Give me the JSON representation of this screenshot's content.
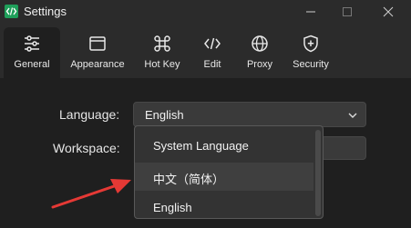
{
  "window": {
    "title": "Settings",
    "controls": [
      "minimize",
      "maximize",
      "close"
    ]
  },
  "tabs": [
    {
      "label": "General",
      "icon": "sliders-icon",
      "active": true
    },
    {
      "label": "Appearance",
      "icon": "window-icon",
      "active": false
    },
    {
      "label": "Hot Key",
      "icon": "command-icon",
      "active": false
    },
    {
      "label": "Edit",
      "icon": "code-icon",
      "active": false
    },
    {
      "label": "Proxy",
      "icon": "globe-icon",
      "active": false
    },
    {
      "label": "Security",
      "icon": "shield-icon",
      "active": false
    }
  ],
  "general": {
    "language_label": "Language:",
    "language_value": "English",
    "workspace_label": "Workspace:"
  },
  "language_options": [
    "System Language",
    "中文（简体）",
    "English"
  ],
  "colors": {
    "background": "#1f1f1f",
    "toolbar": "#2b2b2b",
    "accent_red": "#e53935",
    "app_icon": "#1f9f5a"
  }
}
